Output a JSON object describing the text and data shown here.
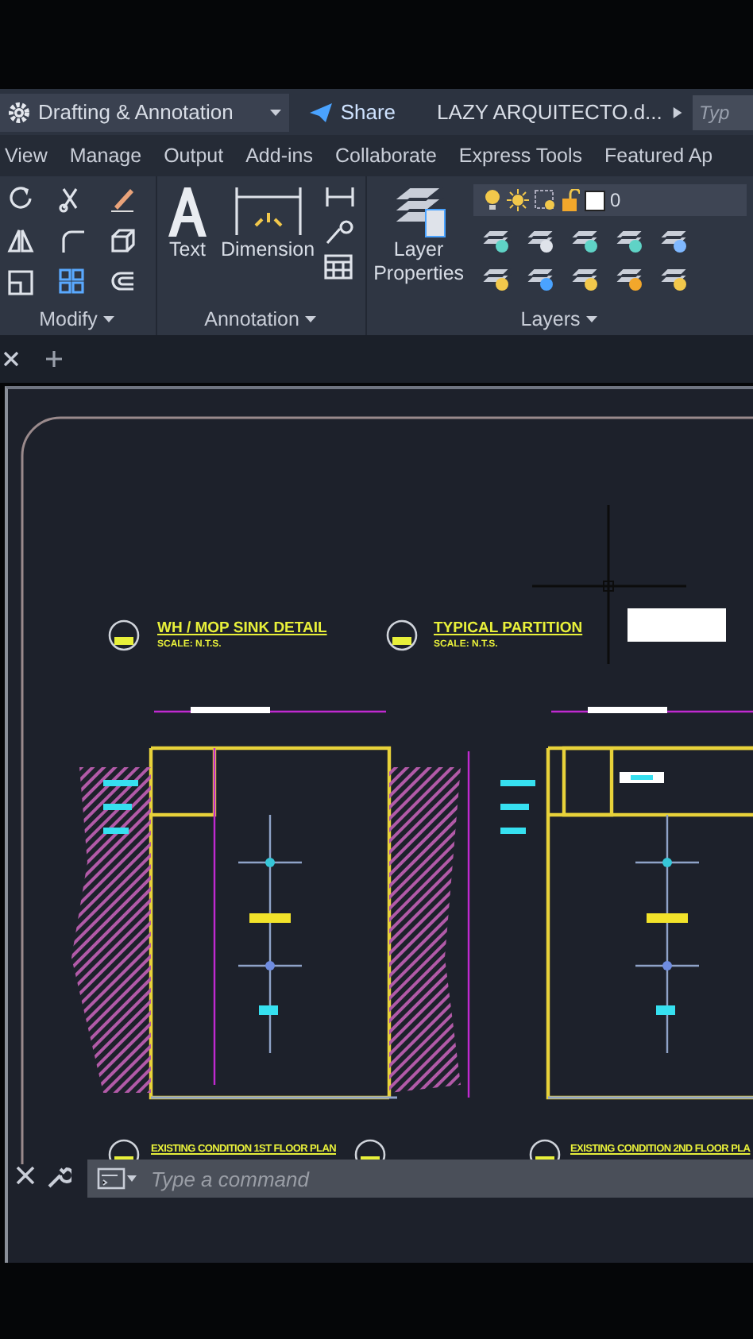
{
  "title_bar": {
    "workspace": "Drafting & Annotation",
    "share": "Share",
    "file_name": "LAZY ARQUITECTO.d...",
    "search_placeholder": "Typ"
  },
  "ribbon_tabs": [
    {
      "label": "View"
    },
    {
      "label": "Manage"
    },
    {
      "label": "Output"
    },
    {
      "label": "Add-ins"
    },
    {
      "label": "Collaborate"
    },
    {
      "label": "Express Tools"
    },
    {
      "label": "Featured Ap"
    }
  ],
  "panels": [
    {
      "kind": "modify",
      "title": "Modify"
    },
    {
      "kind": "annotation",
      "title": "Annotation",
      "tools": [
        {
          "label": "Text"
        },
        {
          "label": "Dimension"
        }
      ]
    },
    {
      "kind": "layers",
      "title": "Layers",
      "tools": [
        {
          "label": "Layer\nProperties"
        }
      ],
      "current_layer": "0"
    }
  ],
  "drawing": {
    "details": [
      {
        "title": "WH / MOP SINK DETAIL",
        "scale": "SCALE: N.T.S."
      },
      {
        "title": "TYPICAL PARTITION",
        "scale": "SCALE: N.T.S."
      }
    ],
    "plan_labels": [
      "EXISTING CONDITION 1ST FLOOR PLAN",
      "EXISTING CONDITION 2ND FLOOR PLA"
    ]
  },
  "command_line": {
    "placeholder": "Type a command"
  }
}
